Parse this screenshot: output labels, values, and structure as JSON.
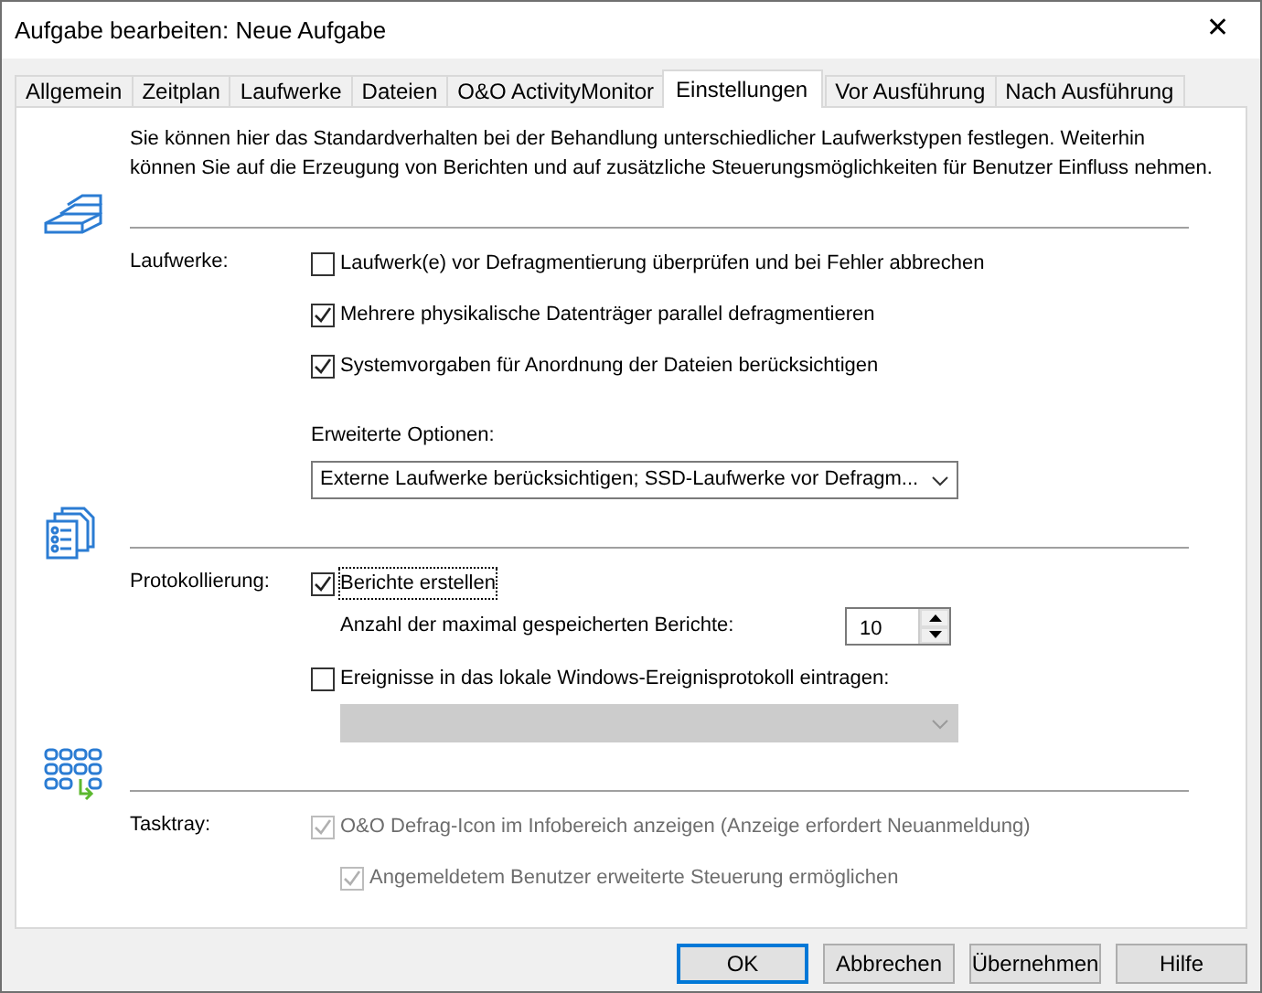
{
  "window": {
    "title": "Aufgabe bearbeiten: Neue Aufgabe",
    "close": "✕"
  },
  "tabs": [
    {
      "label": "Allgemein",
      "selected": false
    },
    {
      "label": "Zeitplan",
      "selected": false
    },
    {
      "label": "Laufwerke",
      "selected": false
    },
    {
      "label": "Dateien",
      "selected": false
    },
    {
      "label": "O&O ActivityMonitor",
      "selected": false
    },
    {
      "label": "Einstellungen",
      "selected": true
    },
    {
      "label": "Vor Ausführung",
      "selected": false
    },
    {
      "label": "Nach Ausführung",
      "selected": false
    }
  ],
  "intro": "Sie können hier das Standardverhalten bei der Behandlung unterschiedlicher Laufwerkstypen festlegen. Weiterhin\nkönnen Sie auf die Erzeugung von Berichten und auf zusätzliche Steuerungsmöglichkeiten für Benutzer Einfluss nehmen.",
  "sections": [
    {
      "label": "Laufwerke:",
      "items": [
        {
          "kind": "checkbox",
          "label": "Laufwerk(e) vor Defragmentierung überprüfen und bei Fehler abbrechen",
          "checked": false,
          "disabled": false,
          "indented": false,
          "focused": false
        },
        {
          "kind": "checkbox",
          "label": "Mehrere physikalische Datenträger parallel defragmentieren",
          "checked": true,
          "disabled": false,
          "indented": false,
          "focused": false
        },
        {
          "kind": "checkbox",
          "label": "Systemvorgaben für Anordnung der Dateien berücksichtigen",
          "checked": true,
          "disabled": false,
          "indented": false,
          "focused": false
        },
        {
          "kind": "caption",
          "label": "Erweiterte Optionen:",
          "indented": false
        },
        {
          "kind": "select",
          "value": "Externe Laufwerke berücksichtigen; SSD-Laufwerke vor Defragm...",
          "disabled": false,
          "indented": false
        }
      ]
    },
    {
      "label": "Protokollierung:",
      "items": [
        {
          "kind": "checkbox",
          "label": "Berichte erstellen",
          "checked": true,
          "disabled": false,
          "indented": false,
          "focused": true
        },
        {
          "kind": "spinner",
          "label": "Anzahl der maximal gespeicherten Berichte:",
          "value": "10",
          "indented": true
        },
        {
          "kind": "checkbox",
          "label": "Ereignisse in das lokale Windows-Ereignisprotokoll eintragen:",
          "checked": false,
          "disabled": false,
          "indented": false,
          "focused": false
        },
        {
          "kind": "select",
          "disabled": true,
          "indented": true
        }
      ]
    },
    {
      "label": "Tasktray:",
      "items": [
        {
          "kind": "checkbox",
          "label": "O&O Defrag-Icon im Infobereich anzeigen (Anzeige erfordert Neuanmeldung)",
          "checked": true,
          "disabled": true,
          "indented": false,
          "focused": false
        },
        {
          "kind": "checkbox",
          "label": "Angemeldetem Benutzer erweiterte Steuerung ermöglichen",
          "checked": true,
          "disabled": true,
          "indented": true,
          "focused": false
        }
      ]
    }
  ],
  "buttons": [
    {
      "label": "OK",
      "default": true
    },
    {
      "label": "Abbrechen",
      "default": false
    },
    {
      "label": "Übernehmen",
      "default": false
    },
    {
      "label": "Hilfe",
      "default": false
    }
  ]
}
